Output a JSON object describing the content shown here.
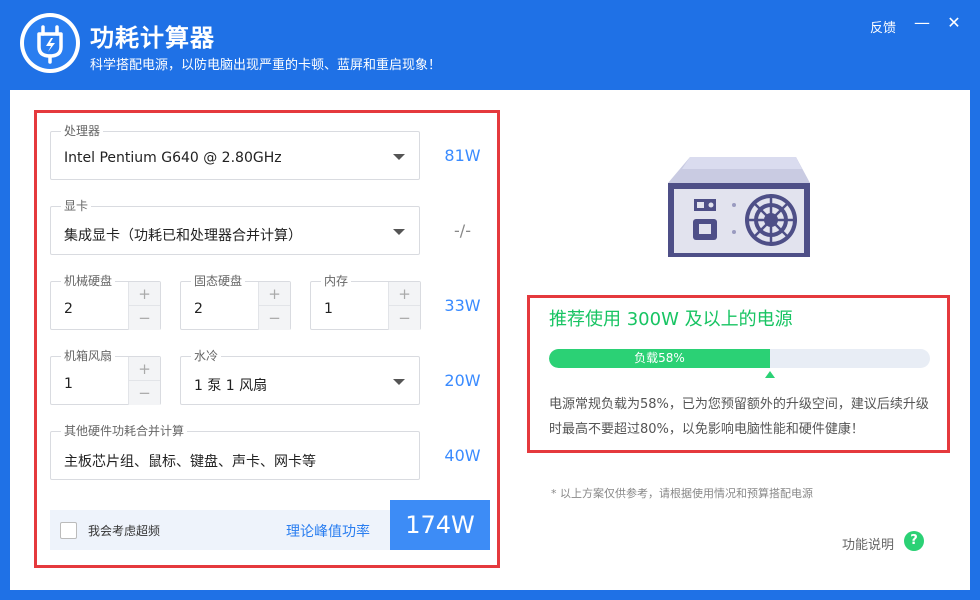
{
  "header": {
    "title": "功耗计算器",
    "subtitle": "科学搭配电源，以防电脑出现严重的卡顿、蓝屏和重启现象！",
    "feedback": "反馈",
    "minimize": "—",
    "close": "✕",
    "logo_icon": "plug-bolt-icon"
  },
  "form": {
    "cpu": {
      "label": "处理器",
      "value": "Intel Pentium G640 @ 2.80GHz",
      "watt": "81W"
    },
    "gpu": {
      "label": "显卡",
      "value": "集成显卡（功耗已和处理器合并计算）",
      "watt": "-/-"
    },
    "hdd": {
      "label": "机械硬盘",
      "value": "2"
    },
    "ssd": {
      "label": "固态硬盘",
      "value": "2"
    },
    "ram": {
      "label": "内存",
      "value": "1"
    },
    "storage_watt": "33W",
    "fans": {
      "label": "机箱风扇",
      "value": "1"
    },
    "water": {
      "label": "水冷",
      "value": "1 泵 1 风扇"
    },
    "cooling_watt": "20W",
    "other": {
      "label": "其他硬件功耗合并计算",
      "value": "主板芯片组、鼠标、键盘、声卡、网卡等",
      "watt": "40W"
    },
    "stepper_plus": "+",
    "stepper_minus": "−"
  },
  "total": {
    "overclock_label": "我会考虑超频",
    "overclock_checked": false,
    "peak_label": "理论峰值功率",
    "value": "174W"
  },
  "recommend": {
    "title": "推荐使用 300W 及以上的电源",
    "load_label": "负载58%",
    "load_percent": 58,
    "description": "电源常规负载为58%，已为您预留额外的升级空间，建议后续升级时最高不要超过80%，以免影响电脑性能和硬件健康！",
    "note": "* 以上方案仅供参考，请根据使用情况和预算搭配电源",
    "help_label": "功能说明",
    "help_icon": "?"
  },
  "colors": {
    "header_bg": "#1f71e6",
    "accent_blue": "#3d8cf6",
    "accent_green": "#2bd175",
    "highlight_red": "#e5393d"
  }
}
